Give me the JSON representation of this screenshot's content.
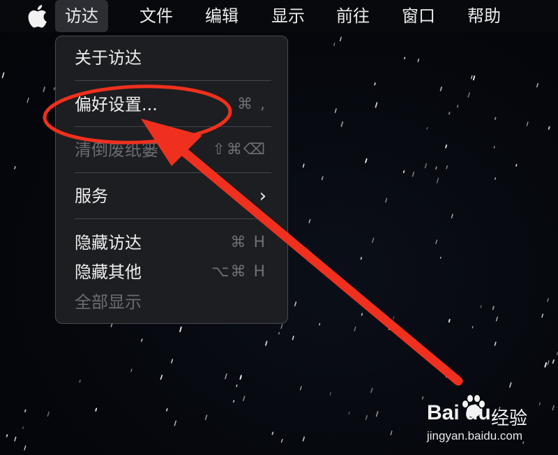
{
  "menubar": {
    "apple_icon": "apple-logo-icon",
    "items": [
      {
        "label": "访达",
        "active": true
      },
      {
        "label": "文件"
      },
      {
        "label": "编辑"
      },
      {
        "label": "显示"
      },
      {
        "label": "前往"
      },
      {
        "label": "窗口"
      },
      {
        "label": "帮助"
      }
    ]
  },
  "dropdown": {
    "items": [
      {
        "label": "关于访达",
        "enabled": true,
        "shortcut": ""
      },
      {
        "label": "偏好设置...",
        "enabled": true,
        "shortcut": "⌘ ,"
      },
      {
        "label": "清倒废纸篓",
        "enabled": false,
        "shortcut": "⇧⌘⌫"
      },
      {
        "label": "服务",
        "enabled": true,
        "submenu": true
      },
      {
        "label": "隐藏访达",
        "enabled": true,
        "shortcut": "⌘ H"
      },
      {
        "label": "隐藏其他",
        "enabled": true,
        "shortcut": "⌥⌘ H"
      },
      {
        "label": "全部显示",
        "enabled": false,
        "shortcut": ""
      }
    ]
  },
  "annotation": {
    "color": "#f0301e",
    "target": "偏好设置..."
  },
  "watermark": {
    "brand": "Bai du",
    "product": "经验",
    "url": "jingyan.baidu.com"
  }
}
